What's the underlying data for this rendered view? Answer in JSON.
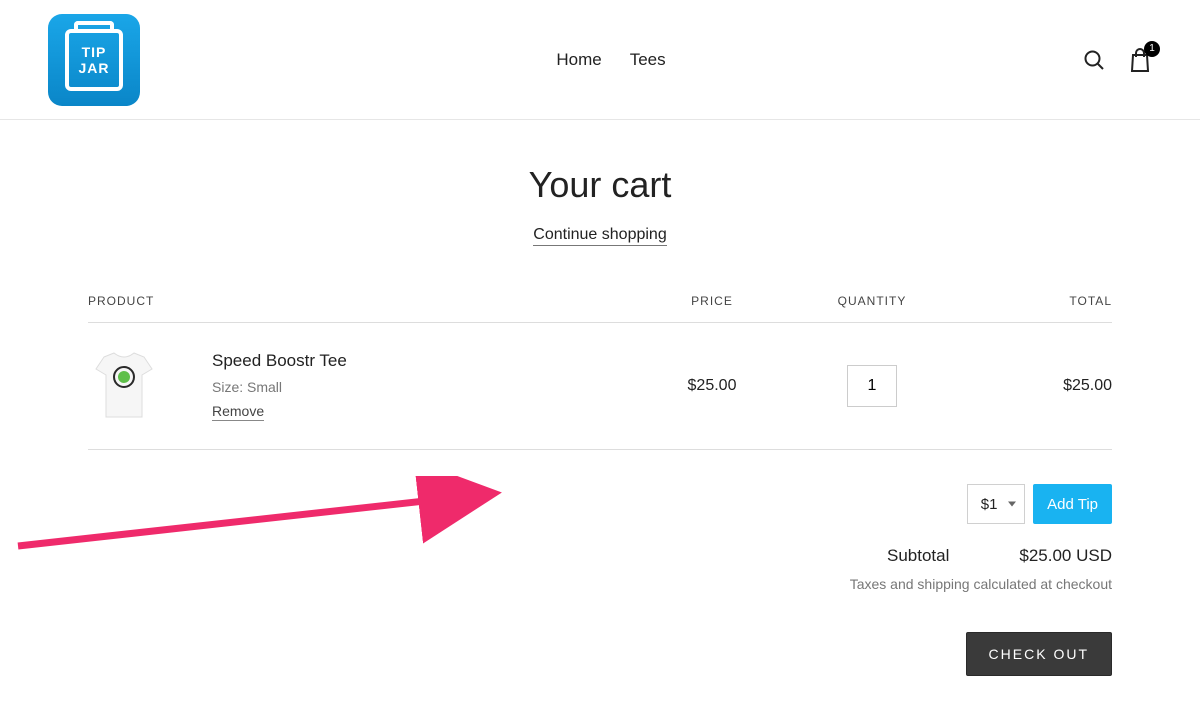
{
  "logo": {
    "line1": "TIP",
    "line2": "JAR"
  },
  "nav": {
    "home": "Home",
    "tees": "Tees"
  },
  "header": {
    "cart_count": "1"
  },
  "page": {
    "title": "Your cart",
    "continue": "Continue shopping"
  },
  "table": {
    "headers": {
      "product": "PRODUCT",
      "price": "PRICE",
      "quantity": "QUANTITY",
      "total": "TOTAL"
    },
    "item": {
      "name": "Speed Boostr Tee",
      "variant": "Size: Small",
      "remove": "Remove",
      "price": "$25.00",
      "qty": "1",
      "line_total": "$25.00"
    }
  },
  "tip": {
    "selected": "$1",
    "button": "Add Tip"
  },
  "summary": {
    "subtotal_label": "Subtotal",
    "subtotal_value": "$25.00 USD",
    "tax_note": "Taxes and shipping calculated at checkout",
    "checkout": "CHECK OUT"
  }
}
